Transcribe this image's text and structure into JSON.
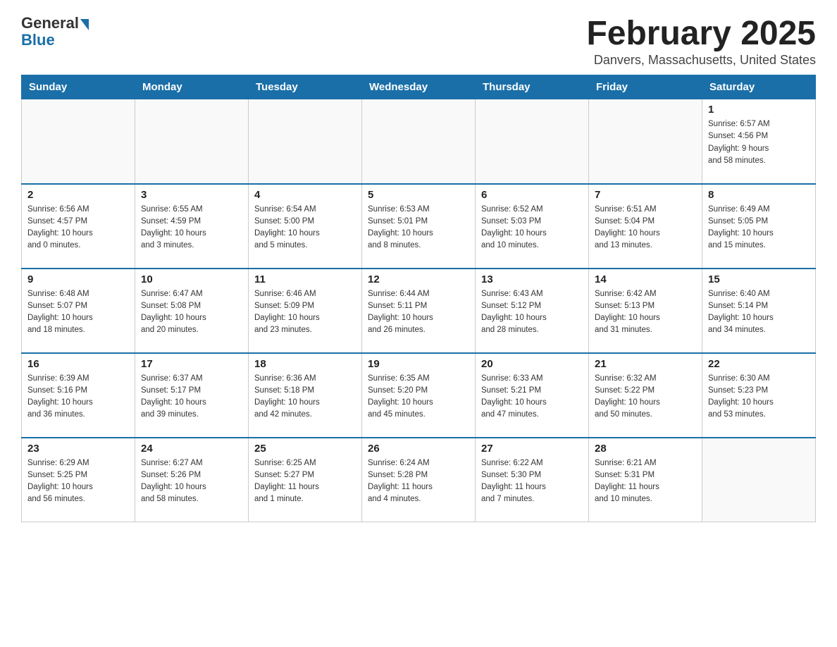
{
  "header": {
    "logo_general": "General",
    "logo_blue": "Blue",
    "month_title": "February 2025",
    "location": "Danvers, Massachusetts, United States"
  },
  "days_of_week": [
    "Sunday",
    "Monday",
    "Tuesday",
    "Wednesday",
    "Thursday",
    "Friday",
    "Saturday"
  ],
  "weeks": [
    {
      "days": [
        {
          "num": "",
          "info": ""
        },
        {
          "num": "",
          "info": ""
        },
        {
          "num": "",
          "info": ""
        },
        {
          "num": "",
          "info": ""
        },
        {
          "num": "",
          "info": ""
        },
        {
          "num": "",
          "info": ""
        },
        {
          "num": "1",
          "info": "Sunrise: 6:57 AM\nSunset: 4:56 PM\nDaylight: 9 hours\nand 58 minutes."
        }
      ]
    },
    {
      "days": [
        {
          "num": "2",
          "info": "Sunrise: 6:56 AM\nSunset: 4:57 PM\nDaylight: 10 hours\nand 0 minutes."
        },
        {
          "num": "3",
          "info": "Sunrise: 6:55 AM\nSunset: 4:59 PM\nDaylight: 10 hours\nand 3 minutes."
        },
        {
          "num": "4",
          "info": "Sunrise: 6:54 AM\nSunset: 5:00 PM\nDaylight: 10 hours\nand 5 minutes."
        },
        {
          "num": "5",
          "info": "Sunrise: 6:53 AM\nSunset: 5:01 PM\nDaylight: 10 hours\nand 8 minutes."
        },
        {
          "num": "6",
          "info": "Sunrise: 6:52 AM\nSunset: 5:03 PM\nDaylight: 10 hours\nand 10 minutes."
        },
        {
          "num": "7",
          "info": "Sunrise: 6:51 AM\nSunset: 5:04 PM\nDaylight: 10 hours\nand 13 minutes."
        },
        {
          "num": "8",
          "info": "Sunrise: 6:49 AM\nSunset: 5:05 PM\nDaylight: 10 hours\nand 15 minutes."
        }
      ]
    },
    {
      "days": [
        {
          "num": "9",
          "info": "Sunrise: 6:48 AM\nSunset: 5:07 PM\nDaylight: 10 hours\nand 18 minutes."
        },
        {
          "num": "10",
          "info": "Sunrise: 6:47 AM\nSunset: 5:08 PM\nDaylight: 10 hours\nand 20 minutes."
        },
        {
          "num": "11",
          "info": "Sunrise: 6:46 AM\nSunset: 5:09 PM\nDaylight: 10 hours\nand 23 minutes."
        },
        {
          "num": "12",
          "info": "Sunrise: 6:44 AM\nSunset: 5:11 PM\nDaylight: 10 hours\nand 26 minutes."
        },
        {
          "num": "13",
          "info": "Sunrise: 6:43 AM\nSunset: 5:12 PM\nDaylight: 10 hours\nand 28 minutes."
        },
        {
          "num": "14",
          "info": "Sunrise: 6:42 AM\nSunset: 5:13 PM\nDaylight: 10 hours\nand 31 minutes."
        },
        {
          "num": "15",
          "info": "Sunrise: 6:40 AM\nSunset: 5:14 PM\nDaylight: 10 hours\nand 34 minutes."
        }
      ]
    },
    {
      "days": [
        {
          "num": "16",
          "info": "Sunrise: 6:39 AM\nSunset: 5:16 PM\nDaylight: 10 hours\nand 36 minutes."
        },
        {
          "num": "17",
          "info": "Sunrise: 6:37 AM\nSunset: 5:17 PM\nDaylight: 10 hours\nand 39 minutes."
        },
        {
          "num": "18",
          "info": "Sunrise: 6:36 AM\nSunset: 5:18 PM\nDaylight: 10 hours\nand 42 minutes."
        },
        {
          "num": "19",
          "info": "Sunrise: 6:35 AM\nSunset: 5:20 PM\nDaylight: 10 hours\nand 45 minutes."
        },
        {
          "num": "20",
          "info": "Sunrise: 6:33 AM\nSunset: 5:21 PM\nDaylight: 10 hours\nand 47 minutes."
        },
        {
          "num": "21",
          "info": "Sunrise: 6:32 AM\nSunset: 5:22 PM\nDaylight: 10 hours\nand 50 minutes."
        },
        {
          "num": "22",
          "info": "Sunrise: 6:30 AM\nSunset: 5:23 PM\nDaylight: 10 hours\nand 53 minutes."
        }
      ]
    },
    {
      "days": [
        {
          "num": "23",
          "info": "Sunrise: 6:29 AM\nSunset: 5:25 PM\nDaylight: 10 hours\nand 56 minutes."
        },
        {
          "num": "24",
          "info": "Sunrise: 6:27 AM\nSunset: 5:26 PM\nDaylight: 10 hours\nand 58 minutes."
        },
        {
          "num": "25",
          "info": "Sunrise: 6:25 AM\nSunset: 5:27 PM\nDaylight: 11 hours\nand 1 minute."
        },
        {
          "num": "26",
          "info": "Sunrise: 6:24 AM\nSunset: 5:28 PM\nDaylight: 11 hours\nand 4 minutes."
        },
        {
          "num": "27",
          "info": "Sunrise: 6:22 AM\nSunset: 5:30 PM\nDaylight: 11 hours\nand 7 minutes."
        },
        {
          "num": "28",
          "info": "Sunrise: 6:21 AM\nSunset: 5:31 PM\nDaylight: 11 hours\nand 10 minutes."
        },
        {
          "num": "",
          "info": ""
        }
      ]
    }
  ]
}
